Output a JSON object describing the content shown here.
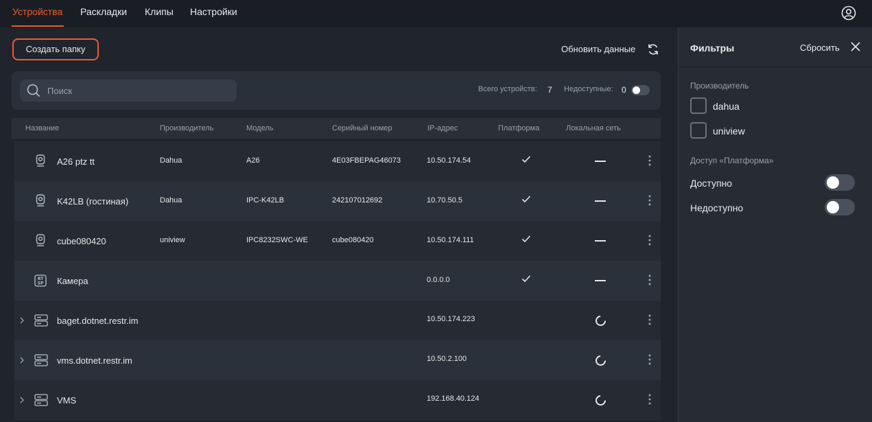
{
  "nav": {
    "tabs": [
      {
        "label": "Устройства",
        "active": true
      },
      {
        "label": "Раскладки"
      },
      {
        "label": "Клипы"
      },
      {
        "label": "Настройки"
      }
    ],
    "account_icon": "user-circle-icon"
  },
  "toolbar": {
    "create_folder": "Создать папку",
    "refresh": "Обновить данные",
    "refresh_icon": "refresh-icon"
  },
  "search": {
    "placeholder": "Поиск",
    "total_label": "Всего устройств:",
    "total_value": "7",
    "unavailable_label": "Недоступные:",
    "unavailable_value": "0",
    "unavailable_toggle_on": false
  },
  "table": {
    "columns": [
      "Название",
      "Производитель",
      "Модель",
      "Серийный номер",
      "IP-адрес",
      "Платформа",
      "Локальная сеть"
    ],
    "rows": [
      {
        "icon": "camera-icon",
        "name": "A26 ptz tt",
        "vendor": "Dahua",
        "model": "A26",
        "serial": "4E03FBEPAG46073",
        "ip": "10.50.174.54",
        "platform": "check",
        "local": "dash"
      },
      {
        "icon": "camera-icon",
        "name": "K42LB (гостиная)",
        "vendor": "Dahua",
        "model": "IPC-K42LB",
        "serial": "242107012692",
        "ip": "10.70.50.5",
        "platform": "check",
        "local": "dash"
      },
      {
        "icon": "camera-icon",
        "name": "cube080420",
        "vendor": "uniview",
        "model": "IPC8232SWC-WE",
        "serial": "cube080420",
        "ip": "10.50.174.111",
        "platform": "check",
        "local": "dash"
      },
      {
        "icon": "rtsp-icon",
        "name": "Камера",
        "vendor": "",
        "model": "",
        "serial": "",
        "ip": "0.0.0.0",
        "platform": "check",
        "local": "dash"
      },
      {
        "icon": "server-icon",
        "name": "baget.dotnet.restr.im",
        "vendor": "",
        "model": "",
        "serial": "",
        "ip": "10.50.174.223",
        "platform": "",
        "local": "loading"
      },
      {
        "icon": "server-icon",
        "name": "vms.dotnet.restr.im",
        "vendor": "",
        "model": "",
        "serial": "",
        "ip": "10.50.2.100",
        "platform": "",
        "local": "loading"
      },
      {
        "icon": "server-icon",
        "name": "VMS",
        "vendor": "",
        "model": "",
        "serial": "",
        "ip": "192.168.40.124",
        "platform": "",
        "local": "loading"
      }
    ]
  },
  "filters": {
    "title": "Фильтры",
    "reset": "Сбросить",
    "vendor_title": "Производитель",
    "vendors": [
      "dahua",
      "uniview"
    ],
    "access_title": "Доступ «Платформа»",
    "access_options": [
      {
        "label": "Доступно",
        "on": false
      },
      {
        "label": "Недоступно",
        "on": false
      }
    ]
  },
  "colors": {
    "accent": "#f05a28",
    "background": "#20252d",
    "panel": "#2a3039"
  }
}
